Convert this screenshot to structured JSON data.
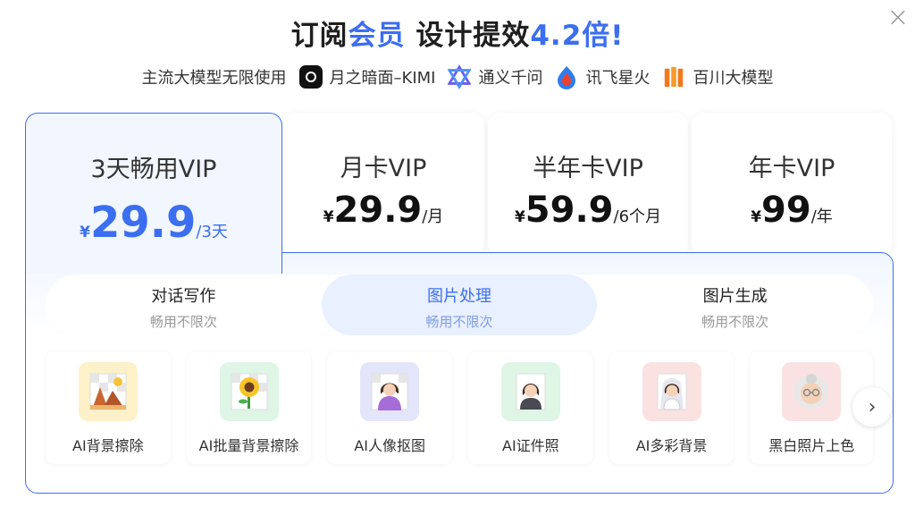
{
  "close_symbol": "×",
  "title": {
    "prefix": "订阅",
    "accent1": "会员",
    "middle": " 设计提效",
    "accent2": "4.2倍",
    "suffix": "!"
  },
  "partners": {
    "lead": "主流大模型无限使用",
    "items": [
      {
        "name": "月之暗面–KIMI",
        "icon": "kimi-icon"
      },
      {
        "name": "通义千问",
        "icon": "qwen-icon"
      },
      {
        "name": "讯飞星火",
        "icon": "xunfei-icon"
      },
      {
        "name": "百川大模型",
        "icon": "baichuan-icon"
      }
    ]
  },
  "plans": [
    {
      "name": "3天畅用VIP",
      "currency": "¥",
      "price": "29.9",
      "unit": "/3天",
      "selected": true
    },
    {
      "name": "月卡VIP",
      "currency": "¥",
      "price": "29.9",
      "unit": "/月",
      "selected": false
    },
    {
      "name": "半年卡VIP",
      "currency": "¥",
      "price": "59.9",
      "unit": "/6个月",
      "selected": false
    },
    {
      "name": "年卡VIP",
      "currency": "¥",
      "price": "99",
      "unit": "/年",
      "selected": false
    }
  ],
  "tabs": [
    {
      "title": "对话写作",
      "sub": "畅用不限次",
      "active": false
    },
    {
      "title": "图片处理",
      "sub": "畅用不限次",
      "active": true
    },
    {
      "title": "图片生成",
      "sub": "畅用不限次",
      "active": false
    }
  ],
  "tools": [
    {
      "label": "AI背景擦除",
      "icon": "desert-landscape-icon",
      "bg": "#fdf1c9"
    },
    {
      "label": "AI批量背景擦除",
      "icon": "sunflower-icon",
      "bg": "#dff5e6"
    },
    {
      "label": "AI人像抠图",
      "icon": "woman-portrait-icon",
      "bg": "#e3e6fb"
    },
    {
      "label": "AI证件照",
      "icon": "id-photo-icon",
      "bg": "#dff5e6"
    },
    {
      "label": "AI多彩背景",
      "icon": "bride-portrait-icon",
      "bg": "#fbe2e2"
    },
    {
      "label": "黑白照片上色",
      "icon": "old-woman-icon",
      "bg": "#fbe2e2"
    }
  ],
  "next_symbol": "›",
  "colors": {
    "accent": "#3b6ef0",
    "panel_bg": "#f1f6ff"
  }
}
